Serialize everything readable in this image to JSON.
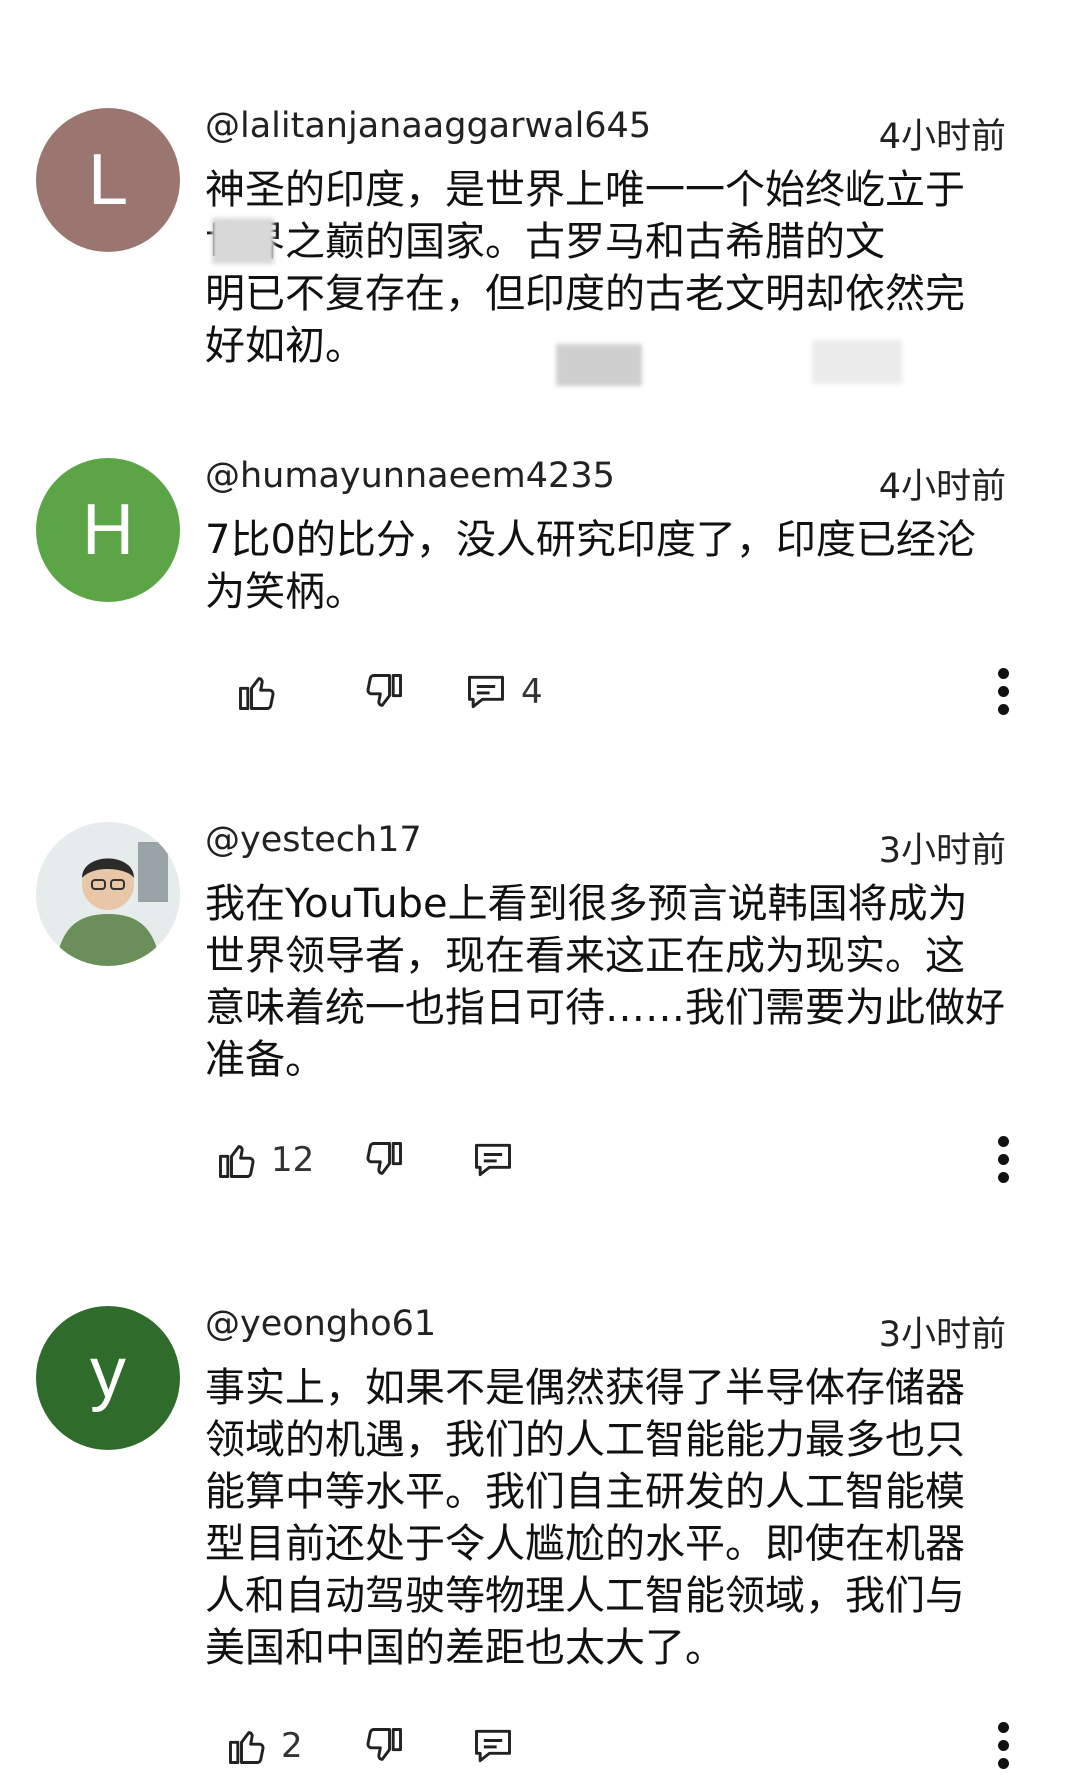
{
  "comments": [
    {
      "avatar_letter": "L",
      "avatar_color": "#9b7671",
      "handle": "@lalitanjanaaggarwal645",
      "time": "4小时前",
      "text": "神圣的印度，是世界上唯一一个始终屹立于\n世界之巅的国家。古罗马和古希腊的文\n明已不复存在，但印度的古老文明却依然完\n好如初。"
    },
    {
      "avatar_letter": "H",
      "avatar_color": "#5ba546",
      "handle": "@humayunnaeem4235",
      "time": "4小时前",
      "text": "7比0的比分，没人研究印度了，印度已经沦\n为笑柄。",
      "reply_count": "4"
    },
    {
      "avatar_letter": "",
      "avatar_color": "#dfe6e6",
      "handle": "@yestech17",
      "time": "3小时前",
      "text": "我在YouTube上看到很多预言说韩国将成为\n世界领导者，现在看来这正在成为现实。这\n意味着统一也指日可待……我们需要为此做好\n准备。",
      "like_count": "12"
    },
    {
      "avatar_letter": "y",
      "avatar_color": "#2f6b2a",
      "handle": "@yeongho61",
      "time": "3小时前",
      "text": "事实上，如果不是偶然获得了半导体存储器\n领域的机遇，我们的人工智能能力最多也只\n能算中等水平。我们自主研发的人工智能模\n型目前还处于令人尴尬的水平。即使在机器\n人和自动驾驶等物理人工智能领域，我们与\n美国和中国的差距也太大了。",
      "like_count": "2"
    }
  ],
  "icons": {
    "like": "thumb-up-icon",
    "dislike": "thumb-down-icon",
    "reply": "reply-comment-icon",
    "more": "more-vertical-icon"
  }
}
